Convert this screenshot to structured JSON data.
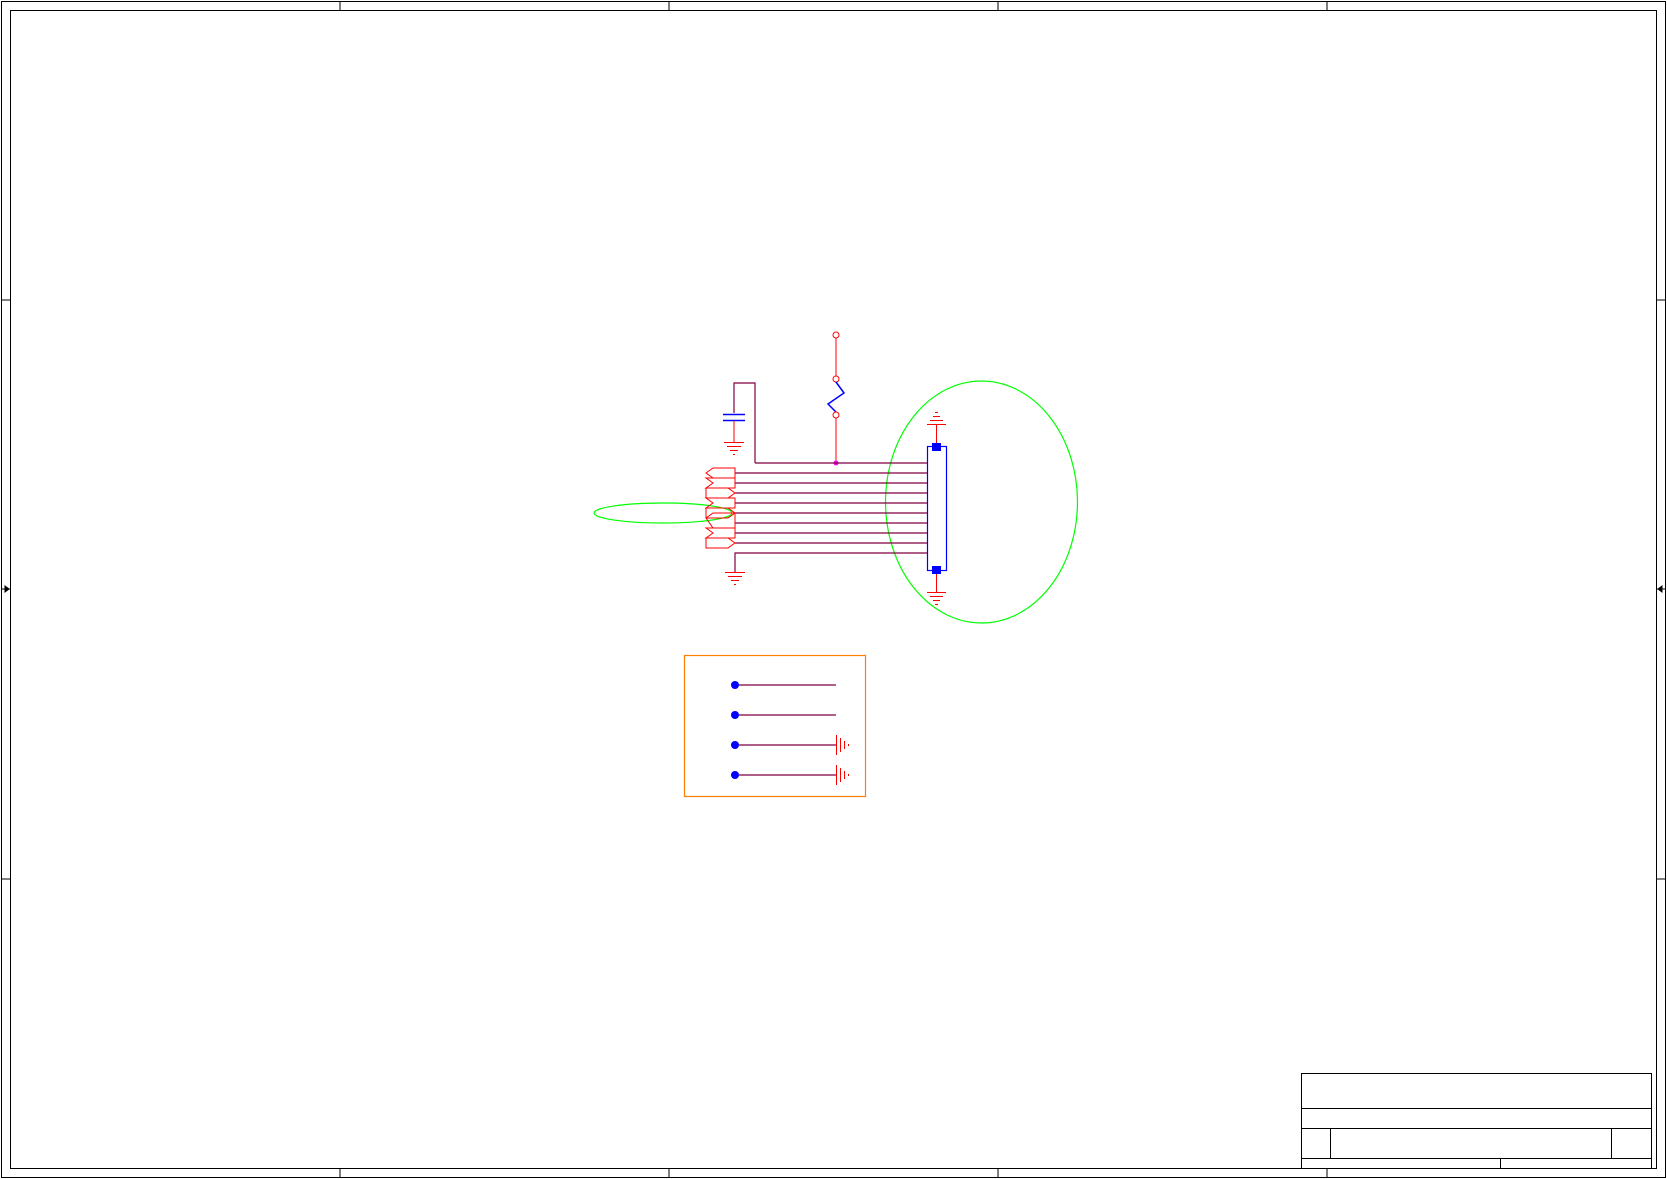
{
  "sheet": {
    "title_block": {
      "title": "",
      "size": "",
      "document_number": "",
      "revision": "",
      "date": "",
      "sheet": ""
    }
  },
  "colors": {
    "border": "#000000",
    "wire": "#800040",
    "part": "#ff0000",
    "body": "#0000ff",
    "junction": "#ff00ff",
    "highlight": "#00ff00",
    "legend_box": "#ff8000"
  },
  "icons": [
    "ground-icon",
    "capacitor-icon",
    "inductor-icon",
    "connector-icon",
    "port-icon",
    "power-pin-icon"
  ]
}
